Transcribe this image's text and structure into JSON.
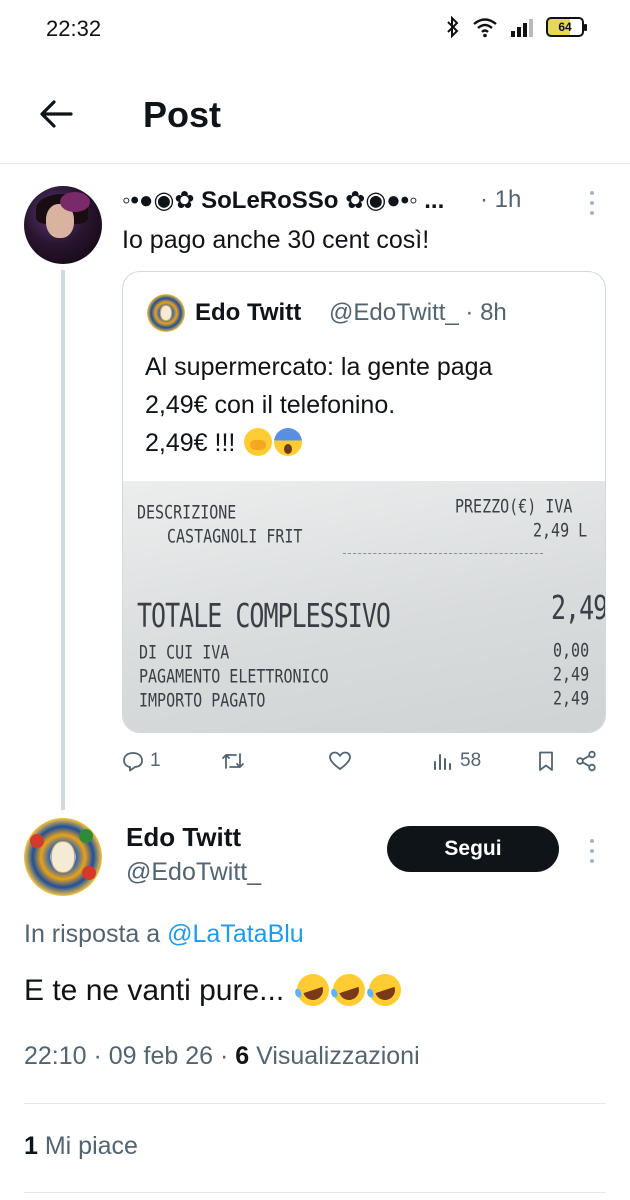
{
  "status_bar": {
    "time": "22:32",
    "battery": "64",
    "icons": [
      "bluetooth-icon",
      "wifi-icon",
      "signal-icon",
      "battery-icon"
    ]
  },
  "header": {
    "back_icon": "arrow-left-icon",
    "title": "Post"
  },
  "parent_tweet": {
    "display_name": "◦•●◉✿ SoLeRoSSo ✿◉●•◦ ...",
    "time": "· 1h",
    "text": "Io pago anche 30 cent così!",
    "quoted": {
      "display_name": "Edo Twitt",
      "handle_time": "@EdoTwitt_ · 8h",
      "lines": [
        "Al supermercato: la gente paga",
        "2,49€ con il telefonino.",
        "2,49€ !!!"
      ],
      "emojis": [
        "face-with-hand-over-mouth-emoji",
        "screaming-face-emoji"
      ],
      "receipt": {
        "header_left": "DESCRIZIONE",
        "header_right": "PREZZO(€) IVA",
        "item_name": "CASTAGNOLI FRIT",
        "item_price": "2,49 L",
        "total_label": "TOTALE COMPLESSIVO",
        "total_value": "2,49",
        "rows": [
          {
            "label": "DI CUI IVA",
            "value": "0,00"
          },
          {
            "label": "PAGAMENTO ELETTRONICO",
            "value": "2,49"
          },
          {
            "label": "IMPORTO PAGATO",
            "value": "2,49"
          }
        ]
      }
    },
    "actions": {
      "replies": "1",
      "retweets": "",
      "likes": "",
      "views": "58"
    }
  },
  "main_tweet": {
    "display_name": "Edo Twitt",
    "handle": "@EdoTwitt_",
    "follow_label": "Segui",
    "reply_prefix": "In risposta a",
    "reply_to": "@LaTataBlu",
    "text": "E te ne vanti pure...",
    "emojis": [
      "rolling-on-floor-laughing-emoji",
      "rolling-on-floor-laughing-emoji",
      "rolling-on-floor-laughing-emoji"
    ],
    "timestamp": "22:10 · 09 feb 26 ·",
    "views_count": "6",
    "views_label": "Visualizzazioni",
    "likes_count": "1",
    "likes_label": "Mi piace"
  },
  "colors": {
    "accent": "#1d9bf0",
    "text": "#0f1419",
    "muted": "#536471",
    "border": "#cfd9de"
  }
}
